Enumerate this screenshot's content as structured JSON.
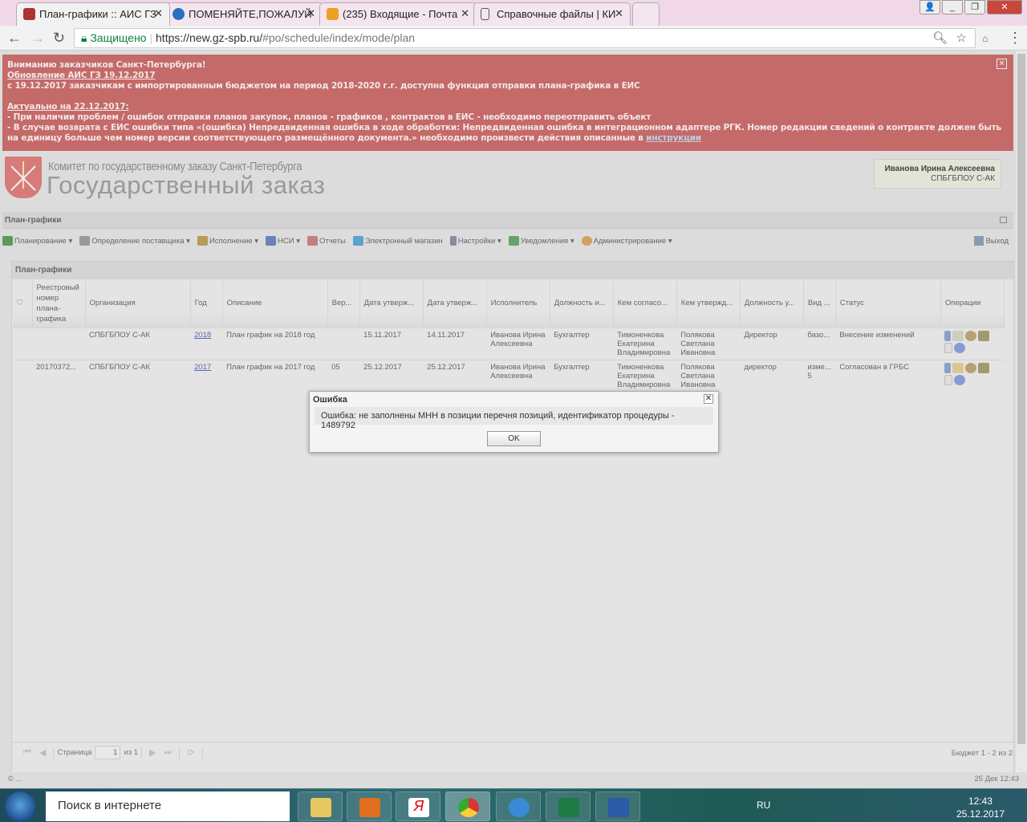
{
  "browser": {
    "tabs": [
      {
        "label": "План-графики :: АИС ГЗ",
        "active": true,
        "icon": "tools-icon"
      },
      {
        "label": "ПОМЕНЯЙТЕ,ПОЖАЛУЙ",
        "icon": "help-icon"
      },
      {
        "label": "(235) Входящие - Почта",
        "icon": "mail-icon"
      },
      {
        "label": "Справочные файлы | КИ",
        "icon": "page-icon"
      }
    ],
    "secure_label": "Защищено",
    "url_host": "https://new.gz-spb.ru/",
    "url_path": "#po/schedule/index/mode/plan"
  },
  "alert": {
    "line1": "Вниманию заказчиков Санкт-Петербурга!",
    "line2": "Обновление АИС ГЗ 19.12.2017",
    "line3": "с 19.12.2017 заказчикам с импортированным бюджетом на период 2018-2020 г.г.  доступна функция отправки плана-графика  в ЕИС",
    "line4": "Актуально на 22.12.2017:",
    "line5": "- При наличии проблем / ошибок отправки планов закупок, планов - графиков , контрактов в ЕИС - необходимо переотправить объект",
    "line6": "- В случае возврата с ЕИС ошибки типа «(ошибка) Непредвиденная ошибка в ходе обработки: Непредвиденная ошибка в интеграционном адаптере РГК. Номер редакции сведений о контракте должен быть на единицу больше чем номер версии соответствующего размещённого документа.» необходимо произвести действия  описанные в ",
    "link": "инструкции",
    "close": "✕"
  },
  "header": {
    "org_line": "Комитет по государственному заказу Санкт-Петербурга",
    "title": "Государственный заказ",
    "user_name": "Иванова Ирина Алексеевна",
    "user_org": "СПБГБПОУ С-АК"
  },
  "panel_title": "План-графики",
  "menu": [
    {
      "label": "Планирование ▾",
      "icon": "planning-icon",
      "color": "#5a9a5a"
    },
    {
      "label": "Определение поставщика ▾",
      "icon": "supplier-icon",
      "color": "#8a8a8a"
    },
    {
      "label": "Исполнение ▾",
      "icon": "execution-icon",
      "color": "#b89a5a"
    },
    {
      "label": "НСИ ▾",
      "icon": "nsi-icon",
      "color": "#6a82b8"
    },
    {
      "label": "Отчеты",
      "icon": "reports-icon",
      "color": "#c08080"
    },
    {
      "label": "Электронный магазин",
      "icon": "shop-icon",
      "color": "#5aa0d0"
    },
    {
      "label": "Настройки ▾",
      "icon": "settings-icon",
      "color": "#8a8aa0"
    },
    {
      "label": "Уведомления ▾",
      "icon": "notifications-icon",
      "color": "#6aa06a"
    },
    {
      "label": "Администрирование ▾",
      "icon": "admin-icon",
      "color": "#d0a060"
    }
  ],
  "exit_label": "Выход",
  "grid": {
    "title": "План-графики",
    "columns": [
      "Реестровый номер плана-графика",
      "Организация",
      "Год",
      "Описание",
      "Вер...",
      "Дата утверж...",
      "Дата утверж...",
      "Исполнитель",
      "Должность и...",
      "Кем согласо...",
      "Кем утвержд...",
      "Должность у...",
      "Вид ...",
      "Статус",
      "Операции"
    ],
    "rows": [
      [
        "",
        "СПБГБПОУ С-АК",
        "2018",
        "План график на 2018 год",
        "",
        "15.11.2017",
        "14.11.2017",
        "Иванова Ирина Алексеевна",
        "Бухгалтер",
        "Тимоненкова Екатерина Владимировна",
        "Полякова Светлана Ивановна",
        "Директор",
        "базо...",
        "Внесение изменений"
      ],
      [
        "20170372...",
        "СПБГБПОУ С-АК",
        "2017",
        "План график на 2017 год",
        "05",
        "25.12.2017",
        "25.12.2017",
        "Иванова Ирина Алексеевна",
        "Бухгалтер",
        "Тимоненкова Екатерина Владимировна",
        "Полякова Светлана Ивановна",
        "директор",
        "изме... 5",
        "Согласован в ГРБС"
      ]
    ],
    "paging": {
      "page_label": "Страница",
      "page": "1",
      "of_label": "из 1",
      "summary": "Бюджет 1 - 2 из 2"
    }
  },
  "status": {
    "left": "© ...",
    "right": "25 Дек 12:43"
  },
  "dialog": {
    "title": "Ошибка",
    "message": "Ошибка: не заполнены МНН в позиции перечня позиций, идентификатор процедуры - 1489792",
    "ok": "OK"
  },
  "taskbar": {
    "search": "Поиск в интернете",
    "lang": "RU",
    "time": "12:43",
    "date": "25.12.2017"
  }
}
